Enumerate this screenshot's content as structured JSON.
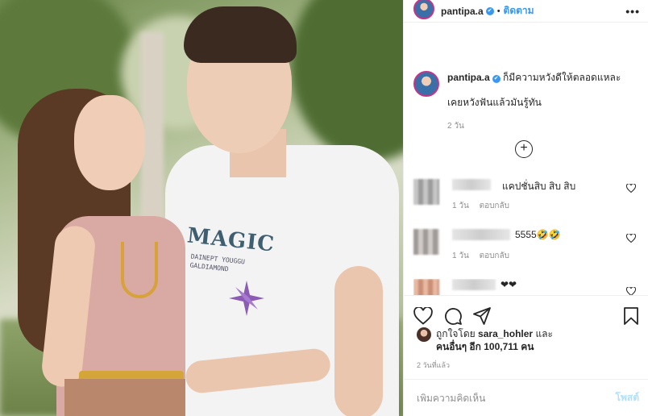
{
  "post": {
    "username": "pantipa.a",
    "verified_mark": "✔",
    "separator": "•",
    "follow_label": "ติดตาม",
    "more_label": "•••"
  },
  "caption": {
    "username": "pantipa.a",
    "text": "ก็มีความหวังดีให้ตลอดแหละ",
    "line2": "เคยหวังฟันแล้วมันรู้ทัน",
    "time": "2 วัน"
  },
  "load_more_label": "+",
  "comments": [
    {
      "text": "แคปชั่นสิบ สิบ สิบ",
      "time": "1 วัน",
      "reply": "ตอบกลับ"
    },
    {
      "text": "5555🤣🤣",
      "time": "1 วัน",
      "reply": "ตอบกลับ"
    },
    {
      "text": "❤❤",
      "time": "",
      "reply": ""
    }
  ],
  "likes": {
    "prefix": "ถูกใจโดย",
    "user": "sara_hohler",
    "and": "และ",
    "others": "คนอื่นๆ อีก 100,711 คน"
  },
  "post_time": "2 วันที่แล้ว",
  "add_comment": {
    "placeholder": "เพิ่มความคิดเห็น",
    "post_label": "โพสต์"
  },
  "photo_text": {
    "title": "MAGIC",
    "sub1": "DAINEPT YOUGGU",
    "sub2": "GALDIAMOND"
  },
  "colors": {
    "accent": "#3897f0",
    "post_disabled": "#b2dffc",
    "muted": "#8e8e8e"
  }
}
